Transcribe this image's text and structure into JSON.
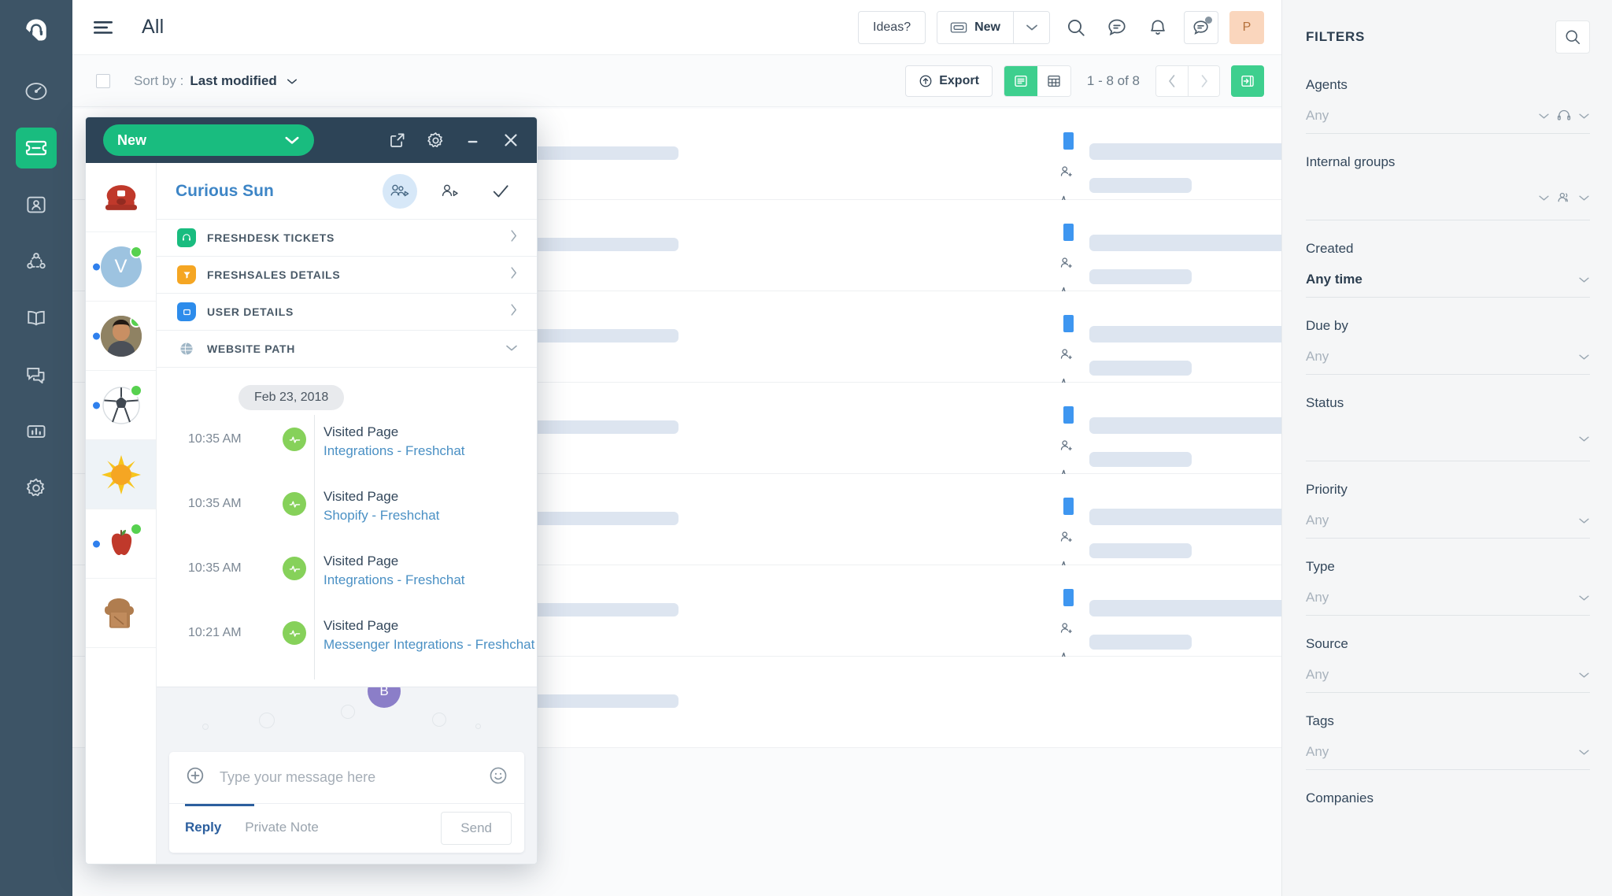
{
  "rail": {
    "items": [
      {
        "name": "freshdesk-logo",
        "icon": "headset-logo"
      },
      {
        "name": "dashboard",
        "icon": "speedometer"
      },
      {
        "name": "tickets",
        "icon": "ticket",
        "active": true
      },
      {
        "name": "contacts",
        "icon": "contact-card"
      },
      {
        "name": "social",
        "icon": "network-nodes"
      },
      {
        "name": "solutions",
        "icon": "open-book"
      },
      {
        "name": "forums",
        "icon": "chat-bubbles"
      },
      {
        "name": "reports",
        "icon": "bar-chart"
      },
      {
        "name": "admin",
        "icon": "gear"
      }
    ]
  },
  "topbar": {
    "title": "All",
    "ideas_label": "Ideas?",
    "new_label": "New",
    "avatar_initial": "P"
  },
  "sortbar": {
    "sort_by_label": "Sort by :",
    "sort_value": "Last modified",
    "export_label": "Export",
    "pager_count": "1 - 8 of 8"
  },
  "tickets": {
    "rows": [
      {
        "id": "row-1"
      },
      {
        "id": "row-2"
      },
      {
        "id": "row-3"
      },
      {
        "id": "row-4"
      },
      {
        "id": "row-5"
      },
      {
        "id": "row-6"
      },
      {
        "id": "row-7"
      }
    ]
  },
  "filters": {
    "title": "FILTERS",
    "groups": [
      {
        "label": "Agents",
        "value": "Any",
        "strong": false,
        "icon": "headset"
      },
      {
        "label": "Internal groups",
        "value": "",
        "strong": false,
        "icon": "people"
      },
      {
        "label": "Created",
        "value": "Any time",
        "strong": true,
        "icon": ""
      },
      {
        "label": "Due by",
        "value": "Any",
        "strong": false,
        "icon": ""
      },
      {
        "label": "Status",
        "value": "",
        "strong": false,
        "icon": ""
      },
      {
        "label": "Priority",
        "value": "Any",
        "strong": false,
        "icon": ""
      },
      {
        "label": "Type",
        "value": "Any",
        "strong": false,
        "icon": ""
      },
      {
        "label": "Source",
        "value": "Any",
        "strong": false,
        "icon": ""
      },
      {
        "label": "Tags",
        "value": "Any",
        "strong": false,
        "icon": ""
      },
      {
        "label": "Companies",
        "value": "",
        "strong": false,
        "icon": ""
      }
    ]
  },
  "chat": {
    "status_label": "New",
    "contact_name": "Curious Sun",
    "conversations": [
      {
        "emoji": "☎",
        "online": false,
        "unread": false,
        "selected": false,
        "kind": "telephone"
      },
      {
        "emoji": "V",
        "online": true,
        "unread": true,
        "selected": false,
        "kind": "initial"
      },
      {
        "emoji": "👤",
        "online": true,
        "unread": true,
        "selected": false,
        "kind": "photo"
      },
      {
        "emoji": "⚽",
        "online": true,
        "unread": true,
        "selected": false,
        "kind": "soccer"
      },
      {
        "emoji": "☀",
        "online": false,
        "unread": false,
        "selected": true,
        "kind": "sun"
      },
      {
        "emoji": "🍎",
        "online": true,
        "unread": true,
        "selected": false,
        "kind": "apple"
      },
      {
        "emoji": "🍞",
        "online": false,
        "unread": false,
        "selected": false,
        "kind": "bread"
      }
    ],
    "accordions": [
      {
        "label": "FRESHDESK TICKETS",
        "color": "#19bc7f",
        "glyph": "headset",
        "expanded": false
      },
      {
        "label": "FRESHSALES DETAILS",
        "color": "#f5a623",
        "glyph": "funnel",
        "expanded": false
      },
      {
        "label": "USER DETAILS",
        "color": "#2d8ceb",
        "glyph": "card",
        "expanded": false
      },
      {
        "label": "WEBSITE PATH",
        "color": "#9fb6c6",
        "glyph": "globe",
        "expanded": true
      }
    ],
    "website_path": {
      "date": "Feb 23, 2018",
      "events": [
        {
          "time": "10:35 AM",
          "kind": "Visited Page",
          "page": "Integrations - Freshchat"
        },
        {
          "time": "10:35 AM",
          "kind": "Visited Page",
          "page": "Shopify - Freshchat"
        },
        {
          "time": "10:35 AM",
          "kind": "Visited Page",
          "page": "Integrations - Freshchat"
        },
        {
          "time": "10:21 AM",
          "kind": "Visited Page",
          "page": "Messenger Integrations - Freshchat"
        }
      ]
    },
    "bubble_initial": "B",
    "composer": {
      "placeholder": "Type your message here",
      "reply_label": "Reply",
      "private_note_label": "Private Note",
      "send_label": "Send"
    }
  },
  "colors": {
    "brand_green": "#19bc7f",
    "rail_bg": "#3d5466",
    "widget_header": "#2d4457",
    "link_blue": "#4a90c4",
    "name_blue": "#3d85c6"
  }
}
